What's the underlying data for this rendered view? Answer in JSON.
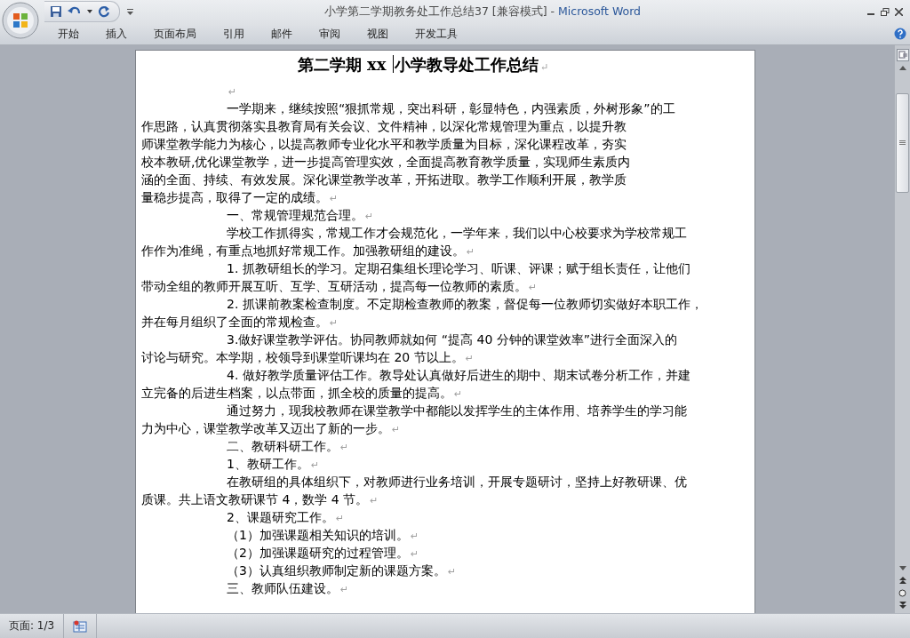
{
  "window": {
    "title": "小学第二学期教务处工作总结37 [兼容模式] -",
    "app_name": "Microsoft Word"
  },
  "ribbon_tabs": [
    {
      "label": "开始"
    },
    {
      "label": "插入"
    },
    {
      "label": "页面布局"
    },
    {
      "label": "引用"
    },
    {
      "label": "邮件"
    },
    {
      "label": "审阅"
    },
    {
      "label": "视图"
    },
    {
      "label": "开发工具"
    }
  ],
  "document": {
    "title": {
      "before_cursor": "第二学期 xx ",
      "after_cursor": "小学教导处工作总结",
      "end_mark": "↵"
    },
    "paragraphs": [
      {
        "end_mark": "↵"
      },
      {
        "lines": [
          "一学期来，继续按照“狠抓常规，突出科研，彰显特色，内强素质，外树形象”的工",
          "作思路，认真贯彻落实县教育局有关会议、文件精神，以深化常规管理为重点，以提升教",
          "师课堂教学能力为核心，以提高教师专业化水平和教学质量为目标，深化课程改革，夯实",
          "校本教研,优化课堂教学，进一步提高管理实效，全面提高教育教学质量，实现师生素质内",
          "涵的全面、持续、有效发展。深化课堂教学改革，开拓进取。教学工作顺利开展，教学质",
          "量稳步提高，取得了一定的成绩。"
        ],
        "end_mark": "↵"
      },
      {
        "lines": [
          "一、常规管理规范合理。"
        ],
        "end_mark": "↵"
      },
      {
        "lines": [
          "学校工作抓得实，常规工作才会规范化，一学年来，我们以中心校要求为学校常规工",
          "作作为准绳，有重点地抓好常规工作。加强教研组的建设。"
        ],
        "end_mark": "↵"
      },
      {
        "lines": [
          "1. 抓教研组长的学习。定期召集组长理论学习、听课、评课；赋于组长责任，让他们",
          "带动全组的教师开展互听、互学、互研活动，提高每一位教师的素质。"
        ],
        "end_mark": "↵"
      },
      {
        "lines": [
          "2. 抓课前教案检查制度。不定期检查教师的教案，督促每一位教师切实做好本职工作，",
          "并在每月组织了全面的常规检查。"
        ],
        "end_mark": "↵"
      },
      {
        "lines": [
          "3.做好课堂教学评估。协同教师就如何 “提高 40 分钟的课堂效率”进行全面深入的",
          "讨论与研究。本学期，校领导到课堂听课均在 20 节以上。"
        ],
        "end_mark": "↵"
      },
      {
        "lines": [
          "4. 做好教学质量评估工作。教导处认真做好后进生的期中、期末试卷分析工作，并建",
          "立完备的后进生档案，以点带面，抓全校的质量的提高。"
        ],
        "end_mark": "↵"
      },
      {
        "lines": [
          "通过努力，现我校教师在课堂教学中都能以发挥学生的主体作用、培养学生的学习能",
          "力为中心，课堂教学改革又迈出了新的一步。"
        ],
        "end_mark": "↵"
      },
      {
        "lines": [
          "二、教研科研工作。"
        ],
        "end_mark": "↵"
      },
      {
        "lines": [
          "1、教研工作。"
        ],
        "end_mark": "↵"
      },
      {
        "lines": [
          "在教研组的具体组织下，对教师进行业务培训，开展专题研讨，坚持上好教研课、优",
          "质课。共上语文教研课节 4，数学 4 节。"
        ],
        "end_mark": "↵"
      },
      {
        "lines": [
          "2、课题研究工作。"
        ],
        "end_mark": "↵"
      },
      {
        "lines": [
          "（1）加强课题相关知识的培训。"
        ],
        "end_mark": "↵"
      },
      {
        "lines": [
          "（2）加强课题研究的过程管理。"
        ],
        "end_mark": "↵"
      },
      {
        "lines": [
          "（3）认真组织教师制定新的课题方案。"
        ],
        "end_mark": "↵"
      },
      {
        "lines": [
          "三、教师队伍建设。"
        ],
        "end_mark": "↵"
      }
    ]
  },
  "status_bar": {
    "page": "页面: 1/3"
  }
}
